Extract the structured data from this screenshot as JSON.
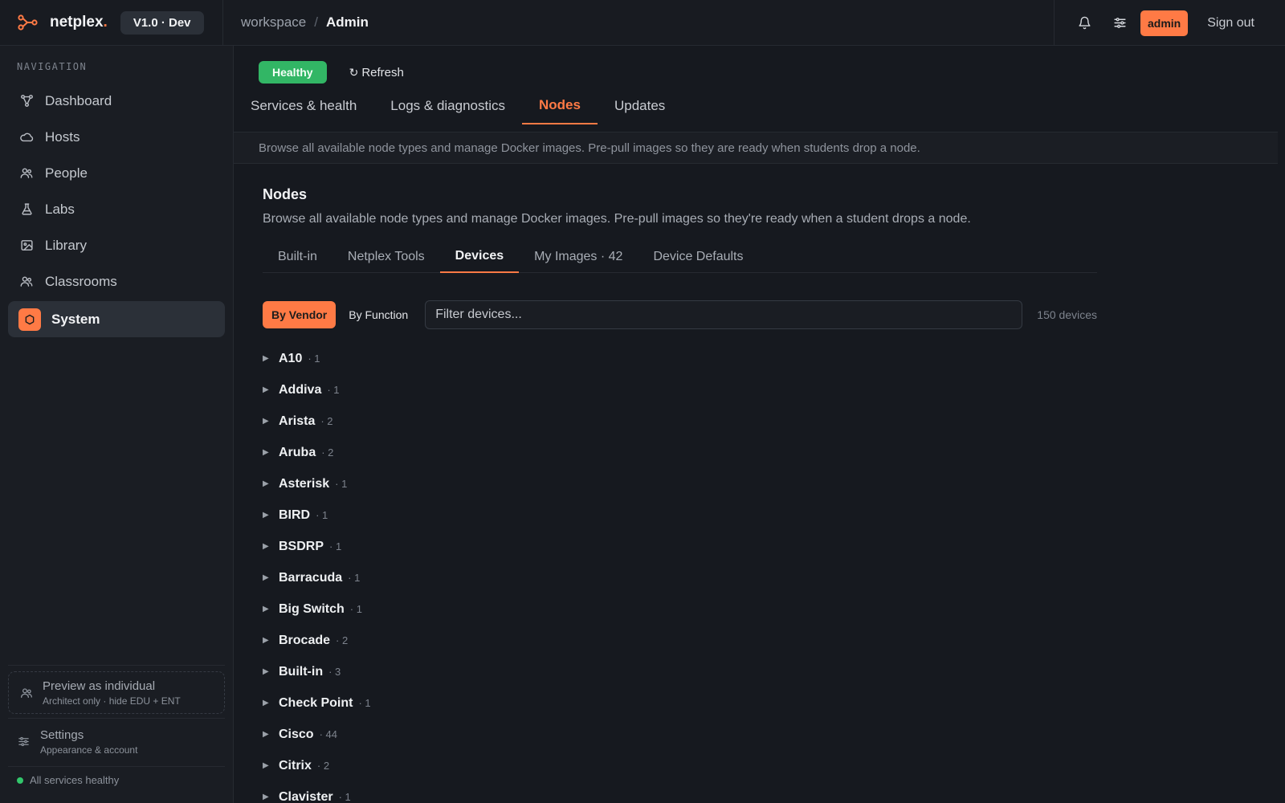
{
  "header": {
    "brand": "netplex",
    "brand_dot": ".",
    "version": "V1.0 · Dev",
    "breadcrumb_root": "workspace",
    "breadcrumb_sep": "/",
    "breadcrumb_current": "Admin",
    "user_badge": "admin",
    "signout": "Sign out"
  },
  "sidebar": {
    "heading": "NAVIGATION",
    "items": [
      {
        "label": "Dashboard",
        "icon": "nodes-icon"
      },
      {
        "label": "Hosts",
        "icon": "cloud-icon"
      },
      {
        "label": "People",
        "icon": "users-icon"
      },
      {
        "label": "Labs",
        "icon": "flask-icon"
      },
      {
        "label": "Library",
        "icon": "image-icon"
      },
      {
        "label": "Classrooms",
        "icon": "users-icon"
      },
      {
        "label": "System",
        "icon": "shield-icon",
        "active": true
      }
    ],
    "preview": {
      "title": "Preview as individual",
      "subtitle": "Architect only · hide EDU + ENT"
    },
    "settings": {
      "title": "Settings",
      "subtitle": "Appearance & account"
    },
    "status": "All services healthy"
  },
  "main": {
    "health_badge": "Healthy",
    "refresh": "Refresh",
    "tabs": [
      "Services & health",
      "Logs & diagnostics",
      "Nodes",
      "Updates"
    ],
    "active_tab": "Nodes",
    "info_strip": "Browse all available node types and manage Docker images. Pre-pull images so they are ready when students drop a node.",
    "section_title": "Nodes",
    "section_desc": "Browse all available node types and manage Docker images. Pre-pull images so they're ready when a student drops a node.",
    "sub_tabs": [
      "Built-in",
      "Netplex Tools",
      "Devices",
      "My Images · 42",
      "Device Defaults"
    ],
    "active_sub_tab": "Devices",
    "group_by_vendor": "By Vendor",
    "group_by_function": "By Function",
    "filter_placeholder": "Filter devices...",
    "device_count": "150 devices",
    "vendors": [
      {
        "name": "A10",
        "count": "· 1"
      },
      {
        "name": "Addiva",
        "count": "· 1"
      },
      {
        "name": "Arista",
        "count": "· 2"
      },
      {
        "name": "Aruba",
        "count": "· 2"
      },
      {
        "name": "Asterisk",
        "count": "· 1"
      },
      {
        "name": "BIRD",
        "count": "· 1"
      },
      {
        "name": "BSDRP",
        "count": "· 1"
      },
      {
        "name": "Barracuda",
        "count": "· 1"
      },
      {
        "name": "Big Switch",
        "count": "· 1"
      },
      {
        "name": "Brocade",
        "count": "· 2"
      },
      {
        "name": "Built-in",
        "count": "· 3"
      },
      {
        "name": "Check Point",
        "count": "· 1"
      },
      {
        "name": "Cisco",
        "count": "· 44"
      },
      {
        "name": "Citrix",
        "count": "· 2"
      },
      {
        "name": "Clavister",
        "count": "· 1"
      }
    ]
  },
  "colors": {
    "accent": "#ff7a45",
    "healthy": "#32b665",
    "background": "#16191f"
  }
}
